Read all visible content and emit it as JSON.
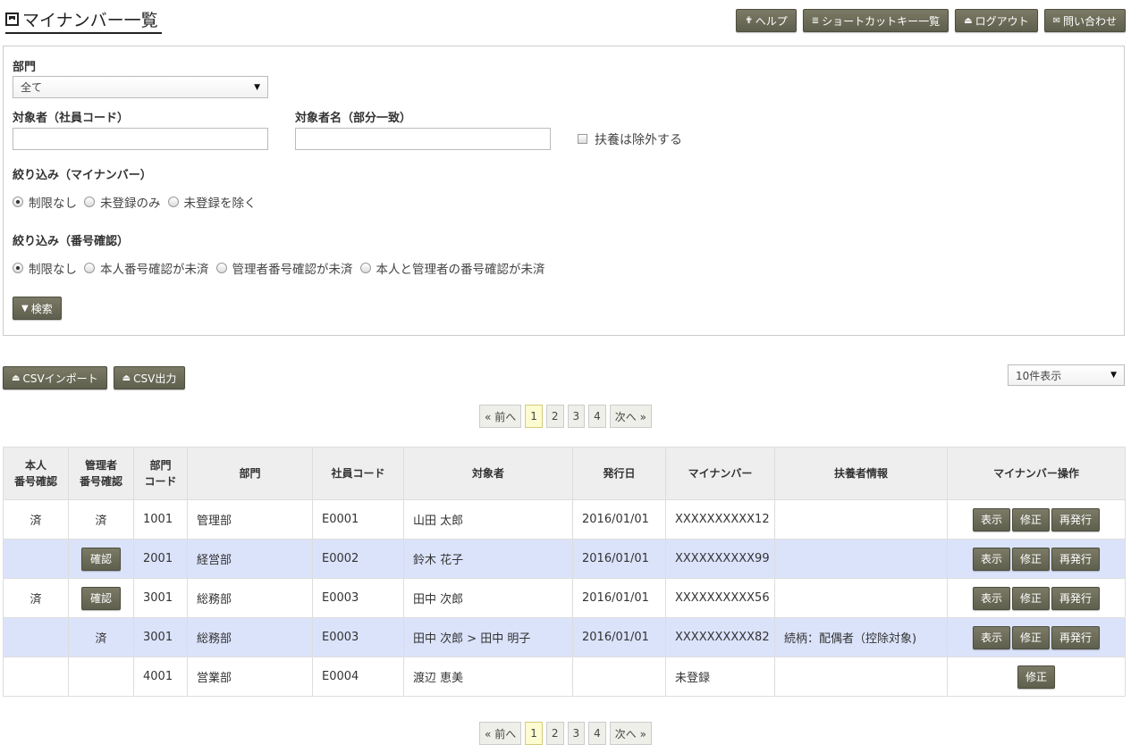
{
  "header": {
    "title": "マイナンバー一覧",
    "buttons": [
      {
        "label": "ヘルプ",
        "icon": "help-icon"
      },
      {
        "label": "ショートカットキー一覧",
        "icon": "list-icon"
      },
      {
        "label": "ログアウト",
        "icon": "eject-icon"
      },
      {
        "label": "問い合わせ",
        "icon": "mail-icon"
      }
    ]
  },
  "search": {
    "dept_label": "部門",
    "dept_value": "全て",
    "code_label": "対象者（社員コード）",
    "code_value": "",
    "name_label": "対象者名（部分一致）",
    "name_value": "",
    "exclude_dependents_label": "扶養は除外する",
    "filter_mynumber_label": "絞り込み（マイナンバー）",
    "filter_mynumber_options": [
      "制限なし",
      "未登録のみ",
      "未登録を除く"
    ],
    "filter_mynumber_selected": 0,
    "filter_confirm_label": "絞り込み（番号確認）",
    "filter_confirm_options": [
      "制限なし",
      "本人番号確認が未済",
      "管理者番号確認が未済",
      "本人と管理者の番号確認が未済"
    ],
    "filter_confirm_selected": 0,
    "search_button": "検索"
  },
  "toolbar": {
    "csv_import": "CSVインポート",
    "csv_export": "CSV出力",
    "per_page": "10件表示"
  },
  "pager": {
    "prev": "« 前へ",
    "pages": [
      "1",
      "2",
      "3",
      "4"
    ],
    "current": "1",
    "next": "次へ »"
  },
  "table": {
    "headers": [
      "本人\n番号確認",
      "管理者\n番号確認",
      "部門\nコード",
      "部門",
      "社員コード",
      "対象者",
      "発行日",
      "マイナンバー",
      "扶養者情報",
      "マイナンバー操作"
    ],
    "rows": [
      {
        "self_check": "済",
        "admin_check": "済",
        "dept_code": "1001",
        "dept": "管理部",
        "emp_code": "E0001",
        "person": "山田 太郎",
        "issued": "2016/01/01",
        "mynumber": "XXXXXXXXXX12",
        "dependent": "",
        "ops": [
          "表示",
          "修正",
          "再発行"
        ]
      },
      {
        "self_check": "",
        "admin_check": "確認",
        "dept_code": "2001",
        "dept": "経営部",
        "emp_code": "E0002",
        "person": "鈴木 花子",
        "issued": "2016/01/01",
        "mynumber": "XXXXXXXXXX99",
        "dependent": "",
        "ops": [
          "表示",
          "修正",
          "再発行"
        ]
      },
      {
        "self_check": "済",
        "admin_check": "確認",
        "dept_code": "3001",
        "dept": "総務部",
        "emp_code": "E0003",
        "person": "田中 次郎",
        "issued": "2016/01/01",
        "mynumber": "XXXXXXXXXX56",
        "dependent": "",
        "ops": [
          "表示",
          "修正",
          "再発行"
        ]
      },
      {
        "self_check": "",
        "admin_check": "済",
        "dept_code": "3001",
        "dept": "総務部",
        "emp_code": "E0003",
        "person": "田中 次郎 > 田中 明子",
        "issued": "2016/01/01",
        "mynumber": "XXXXXXXXXX82",
        "dependent": "続柄：配偶者（控除対象)",
        "ops": [
          "表示",
          "修正",
          "再発行"
        ]
      },
      {
        "self_check": "",
        "admin_check": "",
        "dept_code": "4001",
        "dept": "営業部",
        "emp_code": "E0004",
        "person": "渡辺 恵美",
        "issued": "",
        "mynumber": "未登録",
        "dependent": "",
        "ops": [
          "修正"
        ]
      }
    ]
  },
  "colors": {
    "button": "#6b6b58",
    "row_highlight": "#dbe3fb",
    "unregistered": "#e02020",
    "current_page": "#fdfbd0"
  }
}
